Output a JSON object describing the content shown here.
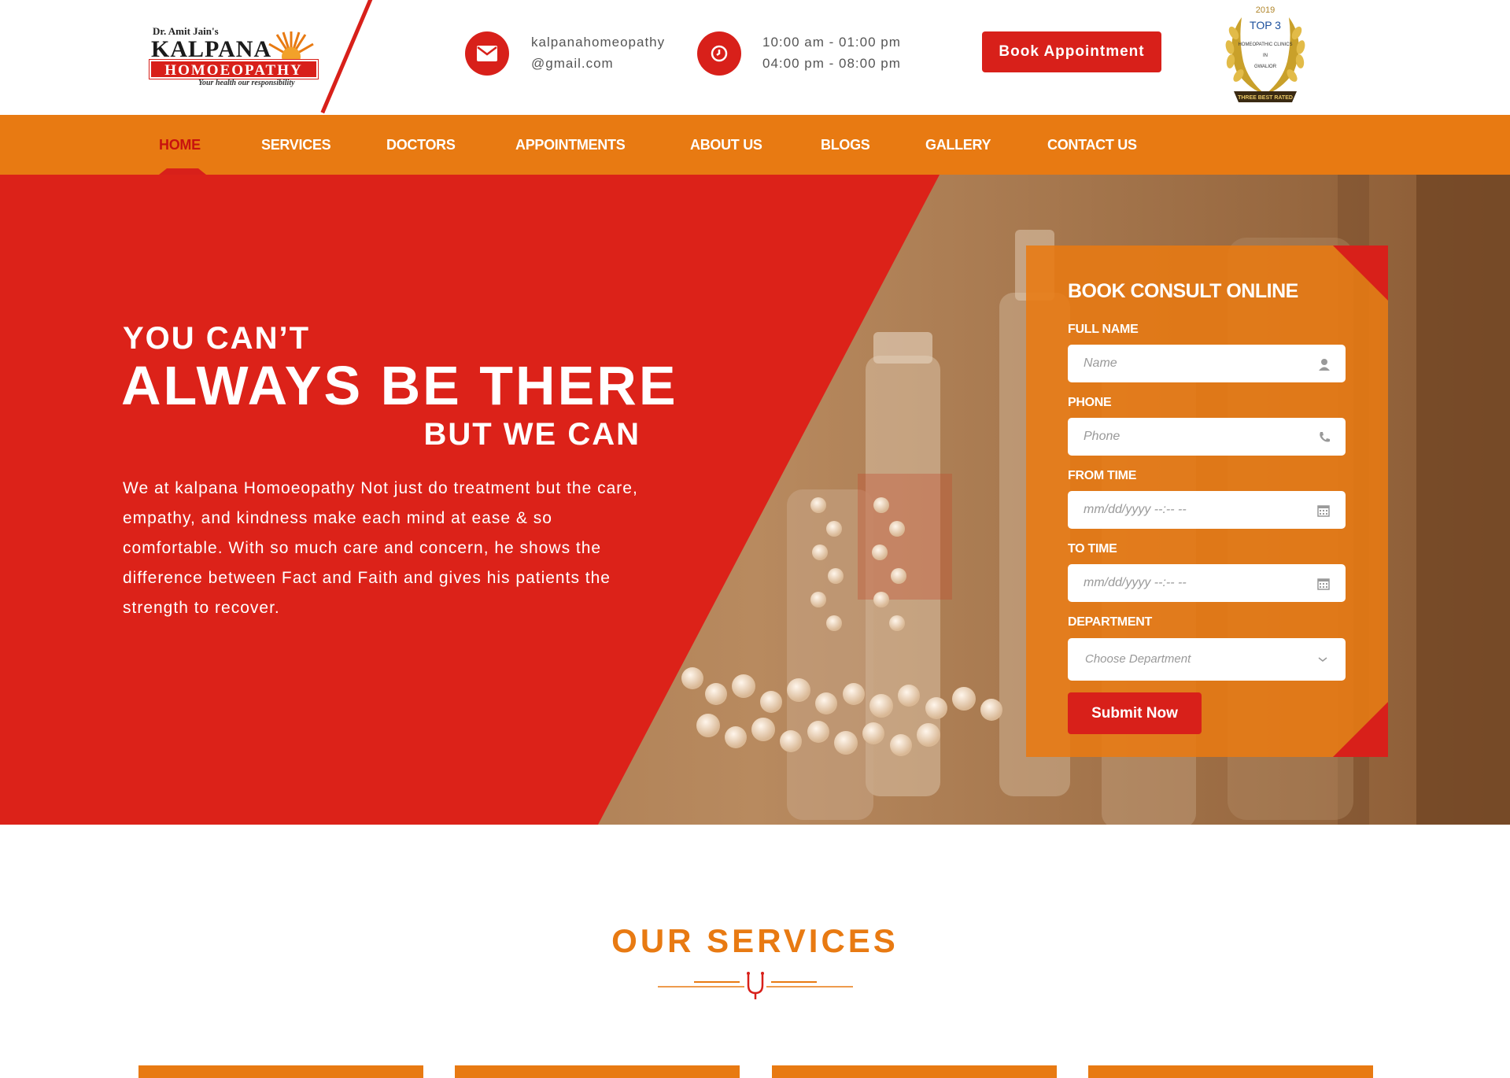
{
  "logo": {
    "pre": "Dr. Amit Jain's",
    "name": "KALPANA",
    "sub": "HOMOEOPATHY",
    "tagline": "Your health our responsibility"
  },
  "contact": {
    "email_line1": "kalpanahomeopathy",
    "email_line2": "@gmail.com",
    "hours_line1": "10:00 am - 01:00 pm",
    "hours_line2": "04:00 pm - 08:00 pm"
  },
  "header": {
    "book_label": "Book Appointment"
  },
  "award": {
    "year": "2019",
    "title": "TOP 3",
    "sub1": "HOMEOPATHIC CLINICS",
    "sub2": "IN",
    "sub3": "GWALIOR",
    "ribbon": "THREE BEST RATED"
  },
  "nav": {
    "items": [
      {
        "label": "HOME",
        "active": true
      },
      {
        "label": "SERVICES"
      },
      {
        "label": "DOCTORS"
      },
      {
        "label": "APPOINTMENTS"
      },
      {
        "label": "ABOUT US"
      },
      {
        "label": "BLOGS"
      },
      {
        "label": "GALLERY"
      },
      {
        "label": "CONTACT US"
      }
    ]
  },
  "hero": {
    "pre": "YOU CAN’T",
    "big": "ALWAYS BE THERE",
    "post": "BUT WE CAN",
    "description": "We at kalpana Homoeopathy Not just do treatment but the care, empathy, and kindness make each mind at ease & so comfortable. With so much care and concern, he shows the difference between Fact and Faith and gives his patients the strength to recover."
  },
  "form": {
    "title": "BOOK CONSULT ONLINE",
    "name_label": "FULL NAME",
    "name_placeholder": "Name",
    "phone_label": "PHONE",
    "phone_placeholder": "Phone",
    "from_label": "FROM TIME",
    "from_placeholder": "mm/dd/yyyy --:-- --",
    "to_label": "TO TIME",
    "to_placeholder": "mm/dd/yyyy --:-- --",
    "dept_label": "DEPARTMENT",
    "dept_value": "Choose Department",
    "submit_label": "Submit Now"
  },
  "services": {
    "title": "OUR SERVICES"
  },
  "colors": {
    "brand_red": "#d8201a",
    "brand_orange": "#e87a12",
    "white": "#ffffff"
  }
}
